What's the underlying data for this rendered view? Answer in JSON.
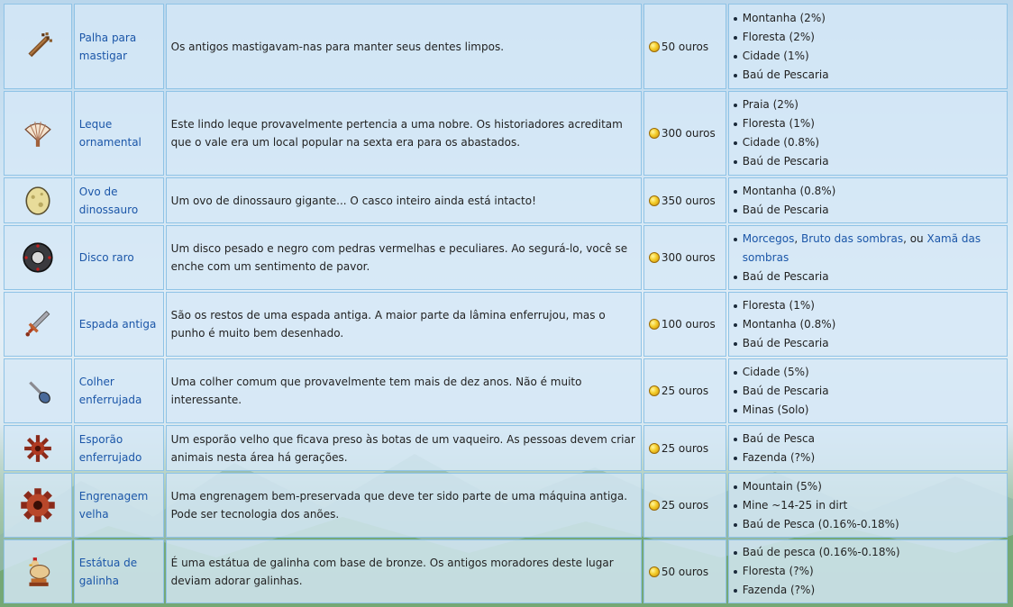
{
  "rows": [
    {
      "icon": "chewing-stick-icon",
      "name": "Palha para mastigar",
      "description": "Os antigos mastigavam-nas para manter seus dentes limpos.",
      "price": "50 ouros",
      "locations": [
        "Montanha (2%)",
        "Floresta (2%)",
        "Cidade (1%)",
        "Baú de Pescaria"
      ]
    },
    {
      "icon": "ornamental-fan-icon",
      "name": "Leque ornamental",
      "description": "Este lindo leque provavelmente pertencia a uma nobre. Os historiadores acreditam que o vale era um local popular na sexta era para os abastados.",
      "price": "300 ouros",
      "locations": [
        "Praia (2%)",
        "Floresta (1%)",
        "Cidade (0.8%)",
        "Baú de Pescaria"
      ]
    },
    {
      "icon": "dinosaur-egg-icon",
      "name": "Ovo de dinossauro",
      "description": "Um ovo de dinossauro gigante... O casco inteiro ainda está intacto!",
      "price": "350 ouros",
      "locations": [
        "Montanha (0.8%)",
        "Baú de Pescaria"
      ]
    },
    {
      "icon": "rare-disc-icon",
      "name": "Disco raro",
      "description": "Um disco pesado e negro com pedras vermelhas e peculiares. Ao segurá-lo, você se enche com um sentimento de pavor.",
      "price": "300 ouros",
      "drop_line": {
        "link1": "Morcegos",
        "sep1": ", ",
        "link2": "Bruto das sombras",
        "sep2": ", ou ",
        "link3": "Xamã das sombras"
      },
      "locations": [
        "Baú de Pescaria"
      ]
    },
    {
      "icon": "ancient-sword-icon",
      "name": "Espada antiga",
      "description": "São os restos de uma espada antiga. A maior parte da lâmina enferrujou, mas o punho é muito bem desenhado.",
      "price": "100 ouros",
      "locations": [
        "Floresta (1%)",
        "Montanha (0.8%)",
        "Baú de Pescaria"
      ]
    },
    {
      "icon": "rusty-spoon-icon",
      "name": "Colher enferrujada",
      "description": "Uma colher comum que provavelmente tem mais de dez anos. Não é muito interessante.",
      "price": "25 ouros",
      "locations": [
        "Cidade (5%)",
        "Baú de Pescaria",
        "Minas (Solo)"
      ]
    },
    {
      "icon": "rusty-spur-icon",
      "name": "Esporão enferrujado",
      "description": "Um esporão velho que ficava preso às botas de um vaqueiro. As pessoas devem criar animais nesta área há gerações.",
      "price": "25 ouros",
      "locations": [
        "Baú de Pesca",
        "Fazenda (?%)"
      ]
    },
    {
      "icon": "rusty-cog-icon",
      "name": "Engrenagem velha",
      "description": "Uma engrenagem bem-preservada que deve ter sido parte de uma máquina antiga. Pode ser tecnologia dos anões.",
      "price": "25 ouros",
      "locations": [
        "Mountain (5%)",
        "Mine ~14-25 in dirt",
        "Baú de Pesca (0.16%-0.18%)"
      ]
    },
    {
      "icon": "chicken-statue-icon",
      "name": "Estátua de galinha",
      "description": "É uma estátua de galinha com base de bronze. Os antigos moradores deste lugar deviam adorar galinhas.",
      "price": "50 ouros",
      "locations": [
        "Baú de pesca (0.16%-0.18%)",
        "Floresta (?%)",
        "Fazenda (?%)"
      ]
    }
  ]
}
